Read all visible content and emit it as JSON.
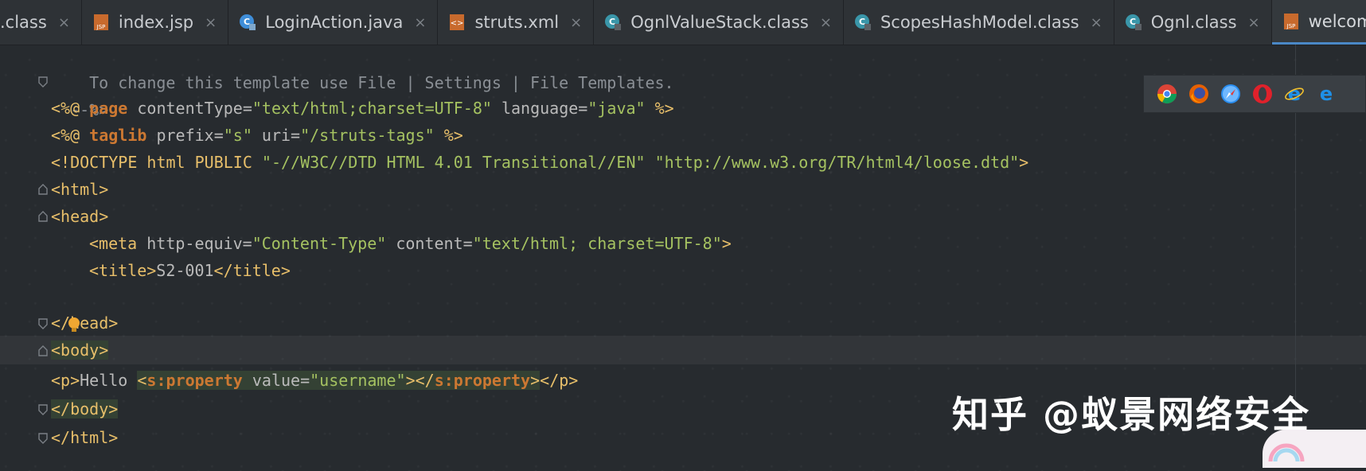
{
  "tabs": [
    {
      "label": ".class",
      "icon": "none",
      "active": false
    },
    {
      "label": "index.jsp",
      "icon": "jsp-file-icon",
      "active": false
    },
    {
      "label": "LoginAction.java",
      "icon": "java-class-icon",
      "active": false
    },
    {
      "label": "struts.xml",
      "icon": "xml-file-icon",
      "active": false
    },
    {
      "label": "OgnlValueStack.class",
      "icon": "class-file-icon",
      "active": false
    },
    {
      "label": "ScopesHashModel.class",
      "icon": "class-file-icon",
      "active": false
    },
    {
      "label": "Ognl.class",
      "icon": "class-file-icon",
      "active": false
    },
    {
      "label": "welcome.jsp",
      "icon": "jsp-file-icon",
      "active": true
    }
  ],
  "tab_close_glyph": "×",
  "code": {
    "l1": "To change this template use File | Settings | File Templates.",
    "l2": "--%>",
    "l3": {
      "open": "<%@ ",
      "kw": "page",
      "a1": " contentType=",
      "v1": "\"text/html;charset=UTF-8\"",
      "a2": " language=",
      "v2": "\"java\"",
      "close": " %>"
    },
    "l4": {
      "open": "<%@ ",
      "kw": "taglib",
      "a1": " prefix=",
      "v1": "\"s\"",
      "a2": " uri=",
      "v2": "\"/struts-tags\"",
      "close": " %>"
    },
    "l5": {
      "open": "<!DOCTYPE html PUBLIC ",
      "v1": "\"-//W3C//DTD HTML 4.01 Transitional//EN\"",
      "sp": " ",
      "v2": "\"http://www.w3.org/TR/html4/loose.dtd\"",
      "close": ">"
    },
    "l6": "<html>",
    "l7": "<head>",
    "l8": {
      "open": "<meta",
      "a1": " http-equiv=",
      "v1": "\"Content-Type\"",
      "a2": " content=",
      "v2": "\"text/html; charset=UTF-8\"",
      "close": ">"
    },
    "l9": {
      "open": "<title>",
      "text": "S2-001",
      "close": "</title>"
    },
    "l10": "</head>",
    "l11": "<body>",
    "l12": {
      "open": "<p>",
      "text": "Hello ",
      "t1": "<",
      "ns1": "s:property",
      "a1": " value=",
      "v1": "\"username\"",
      "t2": "></",
      "ns2": "s:property",
      "t3": ">",
      "close": "</p>"
    },
    "l13": "</body>",
    "l14": "</html>"
  },
  "browsers": [
    "chrome-icon",
    "firefox-icon",
    "safari-icon",
    "opera-icon",
    "ie-icon",
    "edge-icon"
  ],
  "watermark": "知乎 @蚁景网络安全"
}
